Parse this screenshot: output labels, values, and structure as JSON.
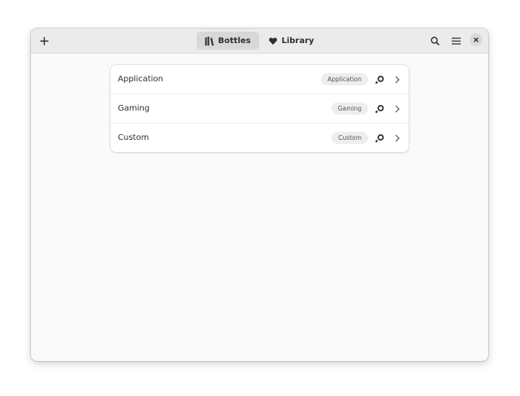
{
  "header": {
    "tabs": [
      {
        "label": "Bottles",
        "icon": "bottles-icon",
        "active": true
      },
      {
        "label": "Library",
        "icon": "heart-icon",
        "active": false
      }
    ],
    "icons": {
      "add": "plus-icon",
      "search": "search-icon",
      "menu": "hamburger-menu-icon",
      "close": "close-icon"
    }
  },
  "bottles": [
    {
      "name": "Application",
      "environment": "Application"
    },
    {
      "name": "Gaming",
      "environment": "Gaming"
    },
    {
      "name": "Custom",
      "environment": "Custom"
    }
  ],
  "colors": {
    "headerbar": "#ebebeb",
    "window": "#fafafa",
    "active_tab": "#d8d8d8",
    "badge": "#eeeeee"
  }
}
